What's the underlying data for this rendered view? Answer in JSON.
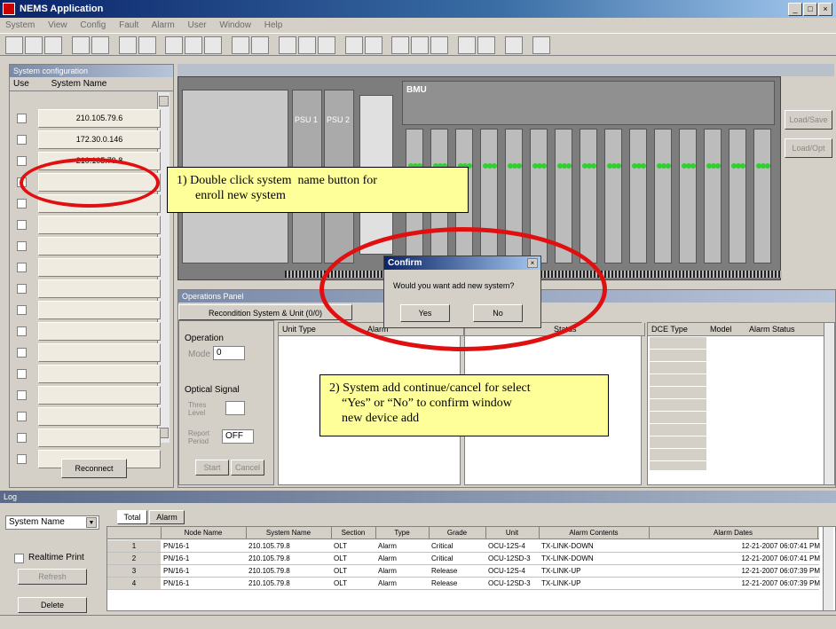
{
  "window": {
    "title": "NEMS Application"
  },
  "menu": [
    "System",
    "View",
    "Config",
    "Fault",
    "Alarm",
    "User",
    "Window",
    "Help"
  ],
  "left_panel": {
    "header": "System configuration",
    "columns": {
      "use": "Use",
      "name": "System Name"
    },
    "systems": [
      "210.105.79.6",
      "172.30.0.146",
      "210.105.79.8",
      "",
      "",
      "",
      "",
      "",
      "",
      "",
      "",
      "",
      "",
      "",
      "",
      "",
      ""
    ],
    "reconnect_label": "Reconnect"
  },
  "rack": {
    "psu1": "PSU 1",
    "psu2": "PSU 2",
    "bmu": "BMU",
    "btn_save": "Load/Save",
    "btn_load": "Load/Opt"
  },
  "callouts": {
    "one": "1) Double click system  name button for\n      enroll new system",
    "two": "2) System add continue/cancel for select\n    “Yes” or “No” to confirm window\n    new device add"
  },
  "dialog": {
    "title": "Confirm",
    "message": "Would you want add new system?",
    "yes": "Yes",
    "no": "No"
  },
  "ops_panel": {
    "header": "Operations Panel",
    "tab": "Recondition System & Unit (0/0)",
    "operation_label": "Operation",
    "mode_label": "Mode",
    "mode_value": "0",
    "optical_label": "Optical Signal",
    "thres_label": "Thres Level",
    "period_label": "Report Period",
    "period_value": "OFF",
    "apply_label": "Start",
    "cancel_label": "Cancel",
    "unit_cols": [
      "Unit Type",
      "Alarm"
    ],
    "status_cols": [
      "",
      "Status"
    ],
    "dce_cols": [
      "DCE Type",
      "Model",
      "Alarm Status"
    ]
  },
  "log": {
    "header": "Log",
    "select_value": "System Name",
    "tabs": [
      "Total",
      "Alarm"
    ],
    "realtime_label": "Realtime Print",
    "refresh_label": "Refresh",
    "delete_label": "Delete",
    "columns": [
      "",
      "Node Name",
      "System Name",
      "Section",
      "Type",
      "Grade",
      "Unit",
      "Alarm Contents",
      "Alarm Dates"
    ],
    "rows": [
      [
        "1",
        "PN/16-1",
        "210.105.79.8",
        "OLT",
        "Alarm",
        "Critical",
        "OCU-12S-4",
        "TX-LINK-DOWN",
        "12-21-2007 06:07:41 PM"
      ],
      [
        "2",
        "PN/16-1",
        "210.105.79.8",
        "OLT",
        "Alarm",
        "Critical",
        "OCU-12SD-3",
        "TX-LINK-DOWN",
        "12-21-2007 06:07:41 PM"
      ],
      [
        "3",
        "PN/16-1",
        "210.105.79.8",
        "OLT",
        "Alarm",
        "Release",
        "OCU-12S-4",
        "TX-LINK-UP",
        "12-21-2007 06:07:39 PM"
      ],
      [
        "4",
        "PN/16-1",
        "210.105.79.8",
        "OLT",
        "Alarm",
        "Release",
        "OCU-12SD-3",
        "TX-LINK-UP",
        "12-21-2007 06:07:39 PM"
      ]
    ]
  },
  "colors": {
    "annotation_red": "#e01010",
    "callout_bg": "#ffff99",
    "title_blue": "#0a246a",
    "led_green": "#2fd02f"
  }
}
